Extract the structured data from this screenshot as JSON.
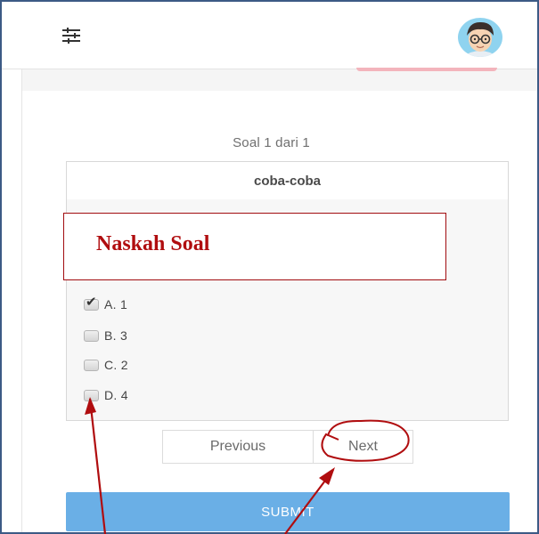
{
  "header": {
    "settings_icon": "sliders-icon",
    "avatar_icon": "user-avatar-icon"
  },
  "quiz": {
    "counter": "Soal 1 dari 1",
    "title": "coba-coba",
    "annotation": "Naskah Soal",
    "options": [
      {
        "label": "A. 1",
        "checked": true
      },
      {
        "label": "B. 3",
        "checked": false
      },
      {
        "label": "C. 2",
        "checked": false
      },
      {
        "label": "D. 4",
        "checked": false
      }
    ]
  },
  "pager": {
    "previous_label": "Previous",
    "next_label": "Next"
  },
  "submit_label": "SUBMIT",
  "colors": {
    "annotation_red": "#b00d0f",
    "submit_blue": "#6aafe6",
    "frame_border": "#3c5a85"
  }
}
